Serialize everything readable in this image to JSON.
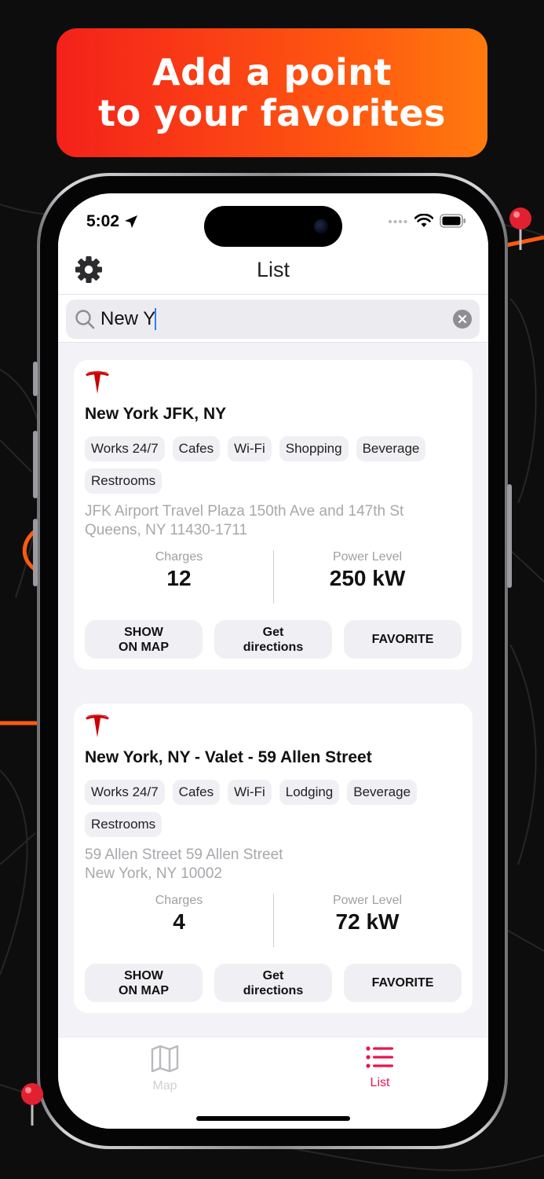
{
  "banner": {
    "line1": "Add a point",
    "line2": "to your favorites"
  },
  "status_bar": {
    "time": "5:02"
  },
  "nav": {
    "title": "List",
    "settings_icon": "gear-icon"
  },
  "search": {
    "value": "New Y",
    "placeholder": ""
  },
  "cards": [
    {
      "title": "New York JFK, NY",
      "tags": [
        "Works 24/7",
        "Cafes",
        "Wi-Fi",
        "Shopping",
        "Beverage",
        "Restrooms"
      ],
      "address_line1": "JFK Airport Travel Plaza 150th Ave and 147th St",
      "address_line2": "Queens, NY 11430-1711",
      "charges_label": "Charges",
      "charges_value": "12",
      "power_label": "Power Level",
      "power_value": "250 kW",
      "show_on_map": "SHOW\nON MAP",
      "get_directions": "Get\ndirections",
      "favorite": "FAVORITE"
    },
    {
      "title": "New York, NY - Valet - 59 Allen Street",
      "tags": [
        "Works 24/7",
        "Cafes",
        "Wi-Fi",
        "Lodging",
        "Beverage",
        "Restrooms"
      ],
      "address_line1": "59 Allen Street 59 Allen Street",
      "address_line2": "New York, NY 10002",
      "charges_label": "Charges",
      "charges_value": "4",
      "power_label": "Power Level",
      "power_value": "72 kW",
      "show_on_map": "SHOW\nON MAP",
      "get_directions": "Get\ndirections",
      "favorite": "FAVORITE"
    }
  ],
  "tab_bar": {
    "map_label": "Map",
    "list_label": "List"
  },
  "colors": {
    "accent": "#e8154f",
    "tesla_red": "#cc0000",
    "banner_start": "#f4211a",
    "banner_end": "#ff7a0e",
    "map_route": "#ff5a10"
  }
}
